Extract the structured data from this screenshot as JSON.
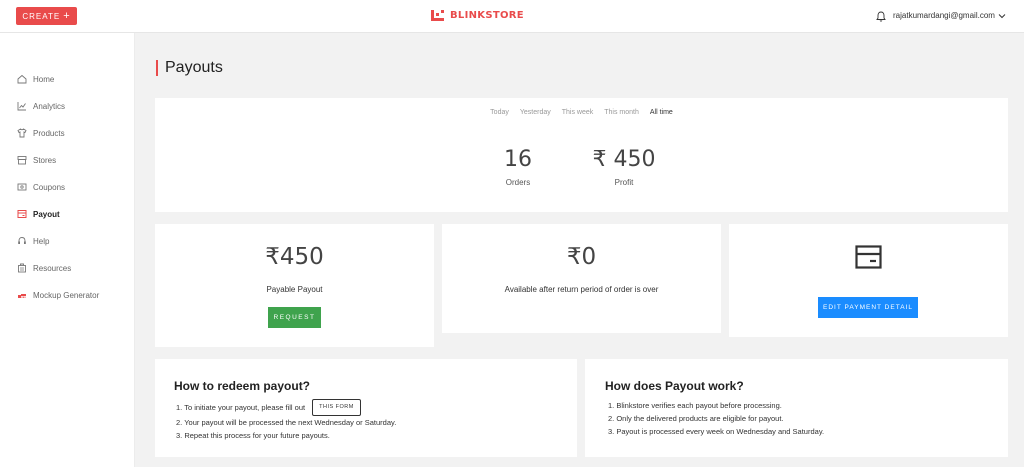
{
  "header": {
    "create_label": "CREATE",
    "create_icon": "plus-icon",
    "logo_text": "BLINKSTORE",
    "brand_color": "#e94b4b",
    "user_email": "rajatkumardangi@gmail.com"
  },
  "sidebar": {
    "items": [
      {
        "label": "Home",
        "icon": "home-icon"
      },
      {
        "label": "Analytics",
        "icon": "analytics-icon"
      },
      {
        "label": "Products",
        "icon": "shirt-icon"
      },
      {
        "label": "Stores",
        "icon": "store-icon"
      },
      {
        "label": "Coupons",
        "icon": "coupon-icon"
      },
      {
        "label": "Payout",
        "icon": "payout-icon",
        "active": true
      },
      {
        "label": "Help",
        "icon": "help-icon"
      },
      {
        "label": "Resources",
        "icon": "resources-icon"
      },
      {
        "label": "Mockup Generator",
        "icon": "mockup-icon"
      }
    ]
  },
  "page": {
    "title": "Payouts"
  },
  "filters": {
    "items": [
      "Today",
      "Yesterday",
      "This week",
      "This month",
      "All time"
    ],
    "active": "All time"
  },
  "stats": {
    "orders_value": "16",
    "orders_label": "Orders",
    "profit_value": "₹ 450",
    "profit_label": "Profit"
  },
  "payable": {
    "amount": "₹450",
    "label": "Payable Payout",
    "button": "REQUEST"
  },
  "available": {
    "amount": "₹0",
    "label": "Available after return period of order is over"
  },
  "payment": {
    "icon": "card-icon",
    "button": "EDIT PAYMENT DETAIL"
  },
  "redeem": {
    "title": "How to redeem payout?",
    "step1": "1. To initiate your payout, please fill out",
    "form_label": "THIS FORM",
    "step2": "2. Your payout will be processed the next Wednesday or Saturday.",
    "step3": "3. Repeat this process for your future payouts."
  },
  "how": {
    "title": "How does Payout work?",
    "steps": [
      "1. Blinkstore verifies each payout before processing.",
      "2. Only the delivered products are eligible for payout.",
      "3. Payout is processed every week on Wednesday and Saturday."
    ]
  }
}
